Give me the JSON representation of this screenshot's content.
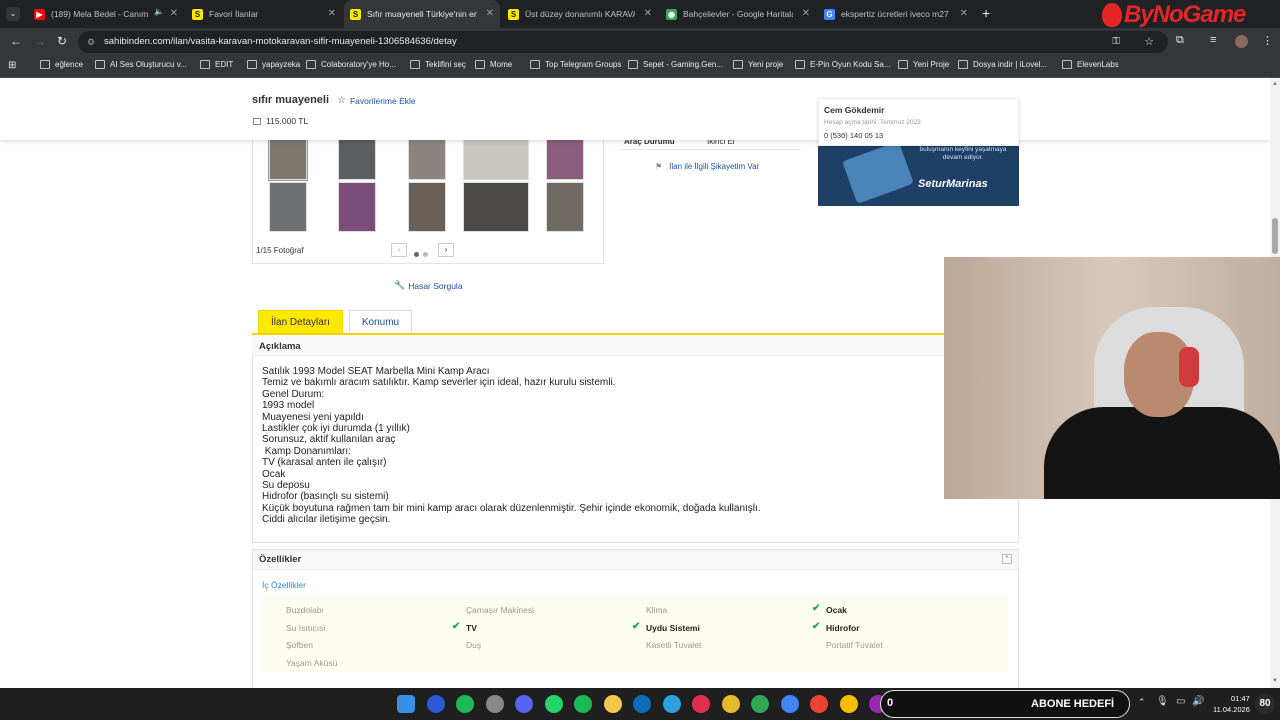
{
  "browser": {
    "tabs": [
      {
        "label": "(189) Mela Bedel - Canım",
        "color": "#ff0000",
        "glyph": "▶"
      },
      {
        "label": "Favori İlanlar",
        "color": "#ffe800",
        "glyph": "S"
      },
      {
        "label": "Sıfır muayeneli Türkiye'nin en b",
        "color": "#ffe800",
        "glyph": "S"
      },
      {
        "label": "Üst düzey donanımlı KARAVAN",
        "color": "#ffe800",
        "glyph": "S"
      },
      {
        "label": "Bahçelievler - Google Haritalar",
        "color": "#34a853",
        "glyph": "◉"
      },
      {
        "label": "ekspertiz ücretleri iveco m27 - G",
        "color": "#4285f4",
        "glyph": "G"
      }
    ],
    "url": "sahibinden.com/ilan/vasita-karavan-motokaravan-sifir-muayeneli-1306584636/detay",
    "bookmarks": [
      "eğlence",
      "AI Ses Oluşturucu v...",
      "EDIT",
      "yapayzeka",
      "Colaboratory'ye Ho...",
      "Teklifini seç",
      "Mome",
      "Top Telegram Groups",
      "Sepet - Gaming.Gen...",
      "Yeni proje",
      "E-Pin Oyun Kodu Sa...",
      "Yeni Proje",
      "Dosya indir | iLovel...",
      "ElevenLabs"
    ]
  },
  "overlay_logo": "ByNoGame",
  "listing": {
    "title": "sıfır muayeneli",
    "favorite_label": "Favorilerime Ekle",
    "price": "115.000 TL",
    "photo_counter": "1/15 Fotoğraf",
    "damage_query": "Hasar Sorgula",
    "spec_label": "Araç Durumu",
    "spec_value": "İkinci El",
    "complaint_link": "İlan ile İlgili Şikayetim Var",
    "seller": {
      "name": "Cem Gökdemir",
      "joined": "Hesap açma tarihi: Temmuz 2023",
      "phone": "0 (530) 140 05 13"
    },
    "ad": {
      "text": "buluşmanın keyfini yaşatmaya devam ediyor.",
      "brand": "SeturMarinas"
    },
    "tabs": [
      "İlan Detayları",
      "Konumu"
    ],
    "description_heading": "Açıklama",
    "description_lines": [
      "Satılık 1993 Model SEAT Marbella Mini Kamp Aracı",
      "Temiz ve bakımlı aracım satılıktır. Kamp severler için ideal, hazır kurulu sistemli.",
      "Genel Durum:",
      "1993 model",
      "Muayenesi yeni yapıldı",
      "Lastikler çok iyi durumda (1 yıllık)",
      "Sorunsuz, aktif kullanılan araç",
      " Kamp Donanımları:",
      "TV (karasal anten ile çalışır)",
      "Ocak",
      "Su deposu",
      "Hidrofor (basınçlı su sistemi)",
      "Küçük boyutuna rağmen tam bir mini kamp aracı olarak düzenlenmiştir. Şehir içinde ekonomik, doğada kullanışlı.",
      "Ciddi alıcılar iletişime geçsin."
    ],
    "features_heading": "Özellikler",
    "features_subheading": "İç Özellikler",
    "features": [
      {
        "label": "Buzdolabı",
        "on": false
      },
      {
        "label": "Çamaşır Makinesi",
        "on": false
      },
      {
        "label": "Klima",
        "on": false
      },
      {
        "label": "Ocak",
        "on": true
      },
      {
        "label": "Su Isıtıcısı",
        "on": false
      },
      {
        "label": "TV",
        "on": true
      },
      {
        "label": "Uydu Sistemi",
        "on": true
      },
      {
        "label": "Hidrofor",
        "on": true
      },
      {
        "label": "Şofben",
        "on": false
      },
      {
        "label": "Duş",
        "on": false
      },
      {
        "label": "Kasetli Tuvalet",
        "on": false
      },
      {
        "label": "Portatif Tuvalet",
        "on": false
      },
      {
        "label": "Yaşam Aküsü",
        "on": false
      }
    ]
  },
  "taskbar": {
    "counter_value": "0",
    "goal_label": "ABONE HEDEFİ",
    "time": "01:47",
    "date": "11.04.2026",
    "badge": "80"
  }
}
